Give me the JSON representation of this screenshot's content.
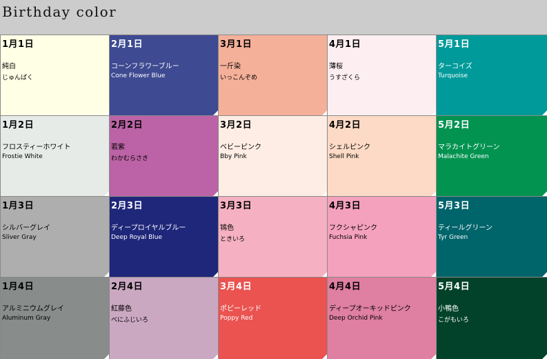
{
  "title": "Birthday color",
  "cells": [
    {
      "date": "1月1日",
      "name_ja": "純白",
      "name_sub": "じゅんぱく",
      "bg": "#ffffe6",
      "fg": "#000000"
    },
    {
      "date": "2月1日",
      "name_ja": "コーンフラワーブルー",
      "name_sub": "Cone Flower Blue",
      "bg": "#3e4a91",
      "fg": "#ffffff"
    },
    {
      "date": "3月1日",
      "name_ja": "一斤染",
      "name_sub": "いっこんぞめ",
      "bg": "#f5b09a",
      "fg": "#000000"
    },
    {
      "date": "4月1日",
      "name_ja": "薄桜",
      "name_sub": "うすざくら",
      "bg": "#fdeff1",
      "fg": "#000000"
    },
    {
      "date": "5月1日",
      "name_ja": "ターコイズ",
      "name_sub": "Turquoise",
      "bg": "#019a9a",
      "fg": "#ffffff"
    },
    {
      "date": "1月2日",
      "name_ja": "フロスティーホワイト",
      "name_sub": "Frostie White",
      "bg": "#e6ebe8",
      "fg": "#000000"
    },
    {
      "date": "2月2日",
      "name_ja": "若紫",
      "name_sub": "わかむらさき",
      "bg": "#bb63a6",
      "fg": "#000000"
    },
    {
      "date": "3月2日",
      "name_ja": "ベビーピンク",
      "name_sub": "Bby Pink",
      "bg": "#fdede4",
      "fg": "#000000"
    },
    {
      "date": "4月2日",
      "name_ja": "シェルピンク",
      "name_sub": "Shell Pink",
      "bg": "#fcdac5",
      "fg": "#000000"
    },
    {
      "date": "5月2日",
      "name_ja": "マラカイトグリーン",
      "name_sub": "Malachite Green",
      "bg": "#039351",
      "fg": "#ffffff"
    },
    {
      "date": "1月3日",
      "name_ja": "シルバーグレイ",
      "name_sub": "Sliver Gray",
      "bg": "#aeaeae",
      "fg": "#000000"
    },
    {
      "date": "2月3日",
      "name_ja": "ディープロイヤルブルー",
      "name_sub": "Deep Royal Blue",
      "bg": "#1f277a",
      "fg": "#ffffff"
    },
    {
      "date": "3月3日",
      "name_ja": "鴇色",
      "name_sub": "ときいろ",
      "bg": "#f5b1c1",
      "fg": "#000000"
    },
    {
      "date": "4月3日",
      "name_ja": "フクシャピンク",
      "name_sub": "Fuchsia Pink",
      "bg": "#f4a1bd",
      "fg": "#000000"
    },
    {
      "date": "5月3日",
      "name_ja": "ティールグリーン",
      "name_sub": "Tyr Green",
      "bg": "#00646b",
      "fg": "#ffffff"
    },
    {
      "date": "1月4日",
      "name_ja": "アルミニウムグレイ",
      "name_sub": "Aluminum Gray",
      "bg": "#888c8b",
      "fg": "#000000"
    },
    {
      "date": "2月4日",
      "name_ja": "紅藤色",
      "name_sub": "べにふじいろ",
      "bg": "#cba8c2",
      "fg": "#000000"
    },
    {
      "date": "3月4日",
      "name_ja": "ポピーレッド",
      "name_sub": "Poppy Red",
      "bg": "#ea5350",
      "fg": "#ffffff"
    },
    {
      "date": "4月4日",
      "name_ja": "ディープオーキッドピンク",
      "name_sub": "Deep Orchid Pink",
      "bg": "#df7fa1",
      "fg": "#000000"
    },
    {
      "date": "5月4日",
      "name_ja": "小鴨色",
      "name_sub": "こがもいろ",
      "bg": "#02412a",
      "fg": "#ffffff"
    }
  ]
}
